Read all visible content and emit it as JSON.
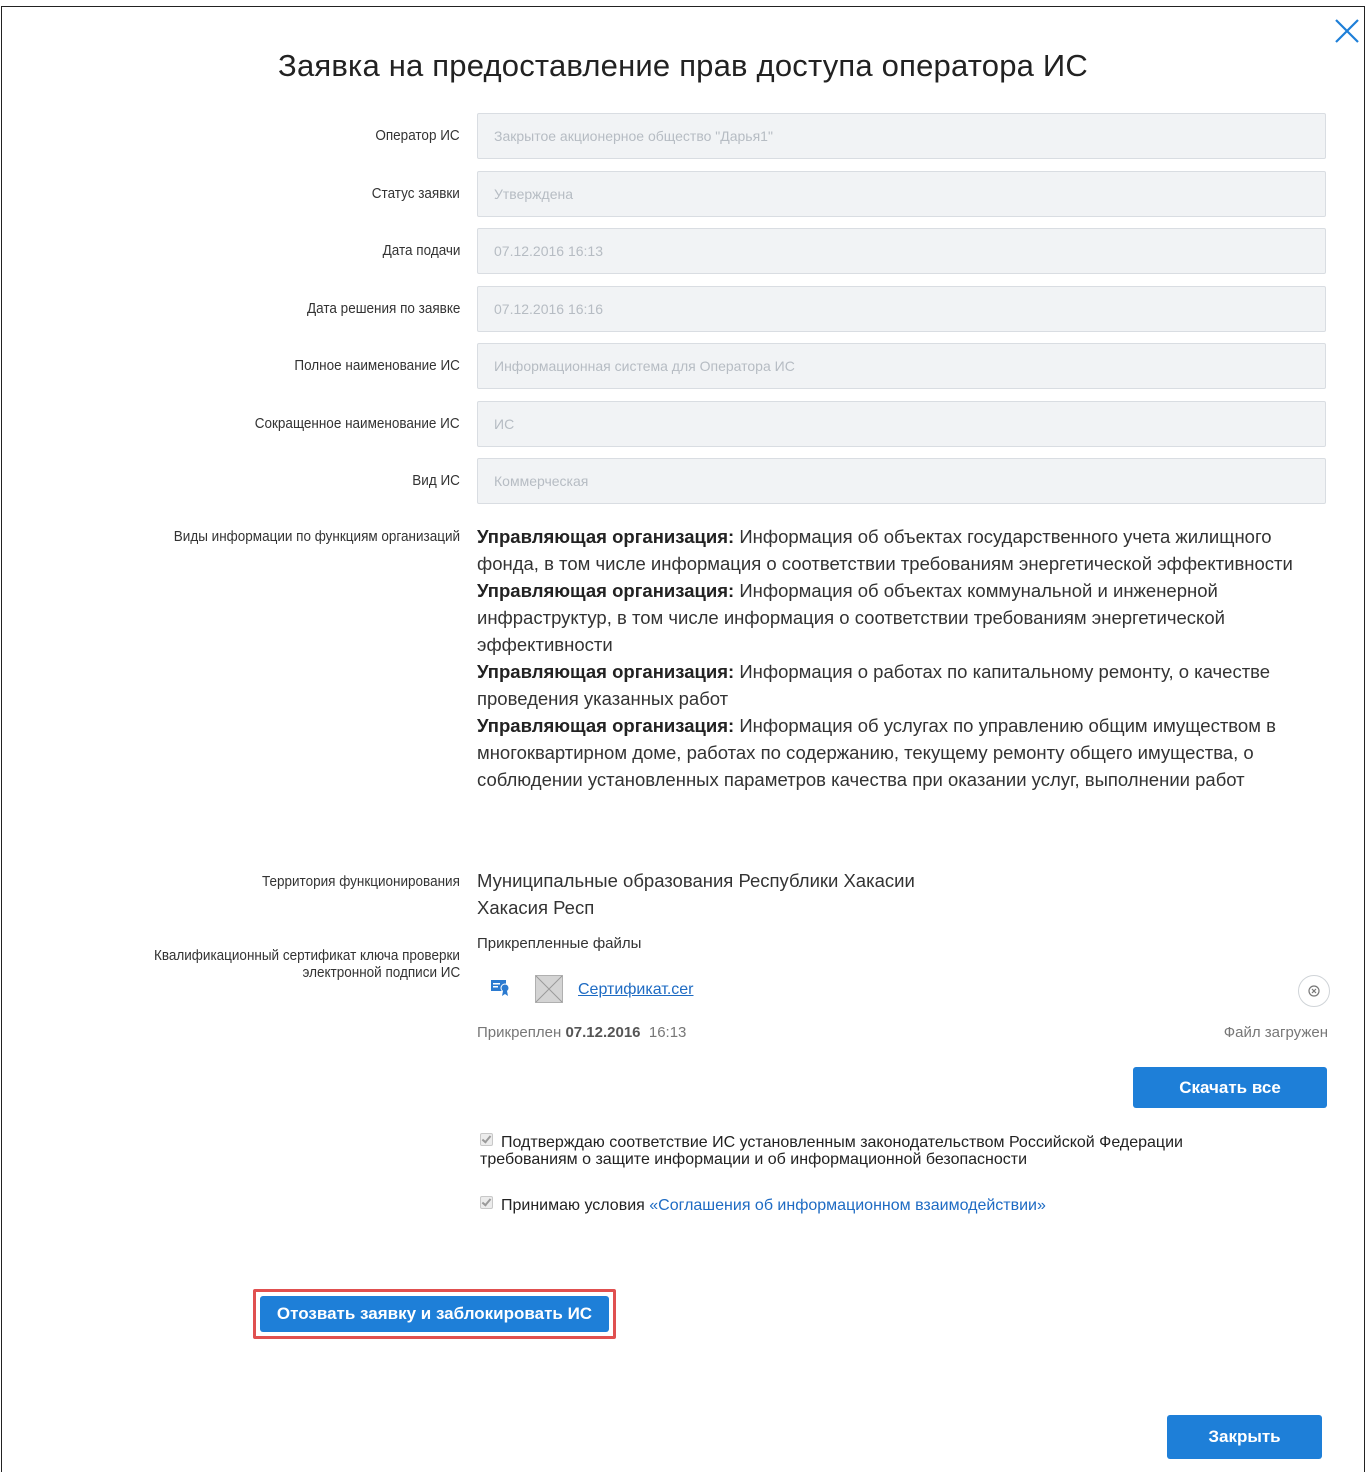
{
  "title": "Заявка на предоставление прав доступа оператора ИС",
  "fields": [
    {
      "label": "Оператор ИС",
      "value": "Закрытое акционерное общество \"Дарья1\""
    },
    {
      "label": "Статус заявки",
      "value": "Утверждена"
    },
    {
      "label": "Дата подачи",
      "value": "07.12.2016 16:13"
    },
    {
      "label": "Дата решения по заявке",
      "value": "07.12.2016 16:16"
    },
    {
      "label": "Полное наименование ИС",
      "value": "Информационная система для Оператора ИС"
    },
    {
      "label": "Сокращенное наименование ИС",
      "value": "ИС"
    },
    {
      "label": "Вид ИС",
      "value": "Коммерческая"
    }
  ],
  "functions": {
    "label": "Виды информации по функциям организаций",
    "items": [
      {
        "org": "Управляющая организация:",
        "text": "Информация об объектах государственного учета жилищного фонда, в том числе информация о соответствии требованиям энергетической эффективности"
      },
      {
        "org": "Управляющая организация:",
        "text": "Информация об объектах коммунальной и инженерной инфраструктур, в том числе информация о соответствии требованиям энергетической эффективности"
      },
      {
        "org": "Управляющая организация:",
        "text": "Информация о работах по капитальному ремонту, о качестве проведения указанных работ"
      },
      {
        "org": "Управляющая организация:",
        "text": "Информация об услугах по управлению общим имуществом в многоквартирном доме, работах по содержанию, текущему ремонту общего имущества, о соблюдении установленных параметров качества при оказании услуг, выполнении работ"
      }
    ]
  },
  "territory": {
    "label": "Территория функционирования",
    "line1": "Муниципальные образования Республики Хакасии",
    "line2": "Хакасия Респ"
  },
  "certificate": {
    "label_line1": "Квалификационный сертификат ключа проверки",
    "label_line2": "электронной подписи ИС",
    "attached_files_label": "Прикрепленные файлы",
    "file_name": "Сертификат.cer",
    "attached_prefix": "Прикреплен",
    "attached_date": "07.12.2016",
    "attached_time": "16:13",
    "status": "Файл загружен",
    "download_all": "Скачать все"
  },
  "confirm1_line1": "Подтверждаю соответствие ИС установленным законодательством Российской Федерации",
  "confirm1_line2": "требованиям о защите информации и об информационной безопасности",
  "confirm2_text": "Принимаю условия ",
  "confirm2_link": "«Соглашения об информационном взаимодействии»",
  "revoke_button": "Отозвать заявку и заблокировать ИС",
  "close_button": "Закрыть",
  "colors": {
    "accent": "#1e7fd8",
    "highlight": "#e05050",
    "link": "#1e6bc3"
  }
}
